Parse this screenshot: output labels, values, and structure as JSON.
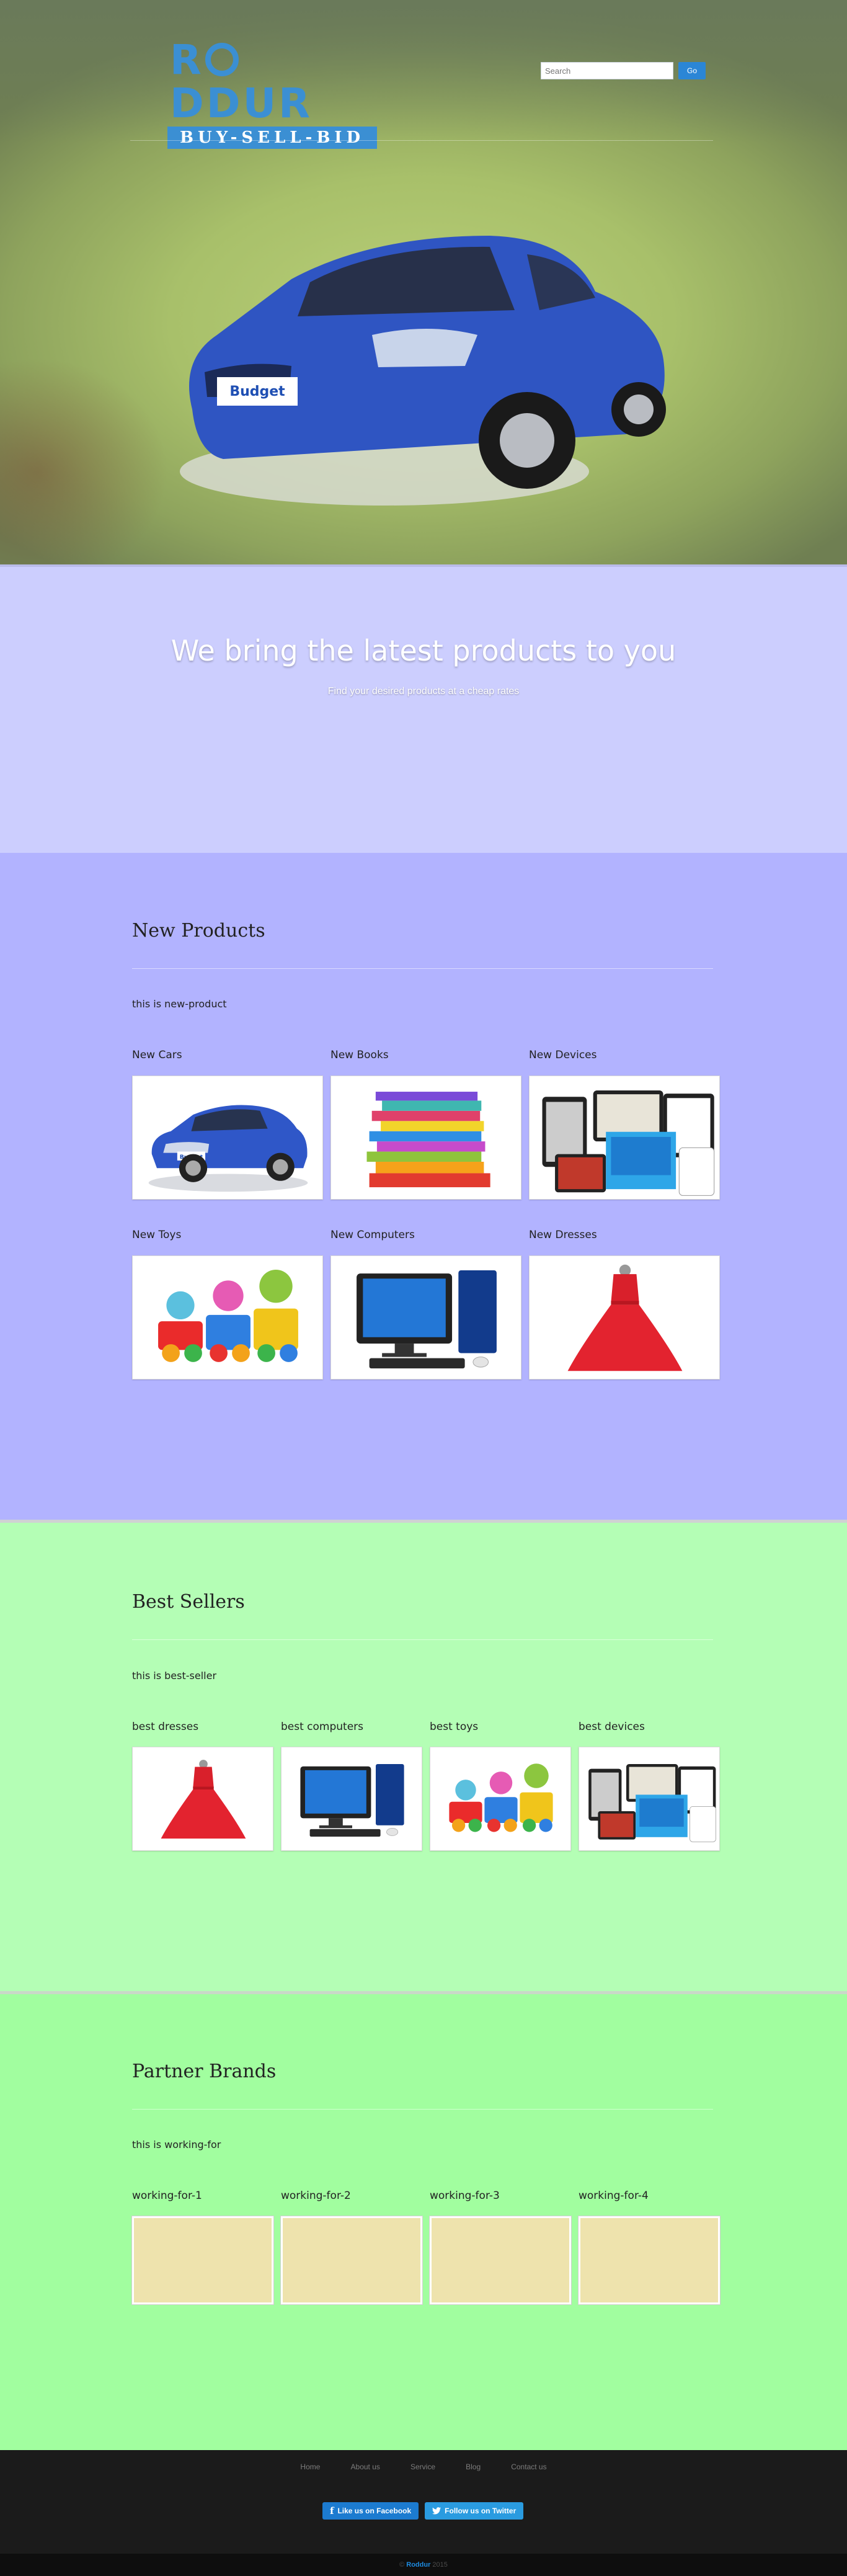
{
  "brand": {
    "name_part1": "R",
    "name_part2": "DDUR",
    "tagline": "BUY-SELL-BID"
  },
  "search": {
    "placeholder": "Search",
    "button": "Go"
  },
  "hero_banner": {
    "headline": "We bring the latest products to you",
    "subline": "Find your desired products at a cheap rates"
  },
  "new_products": {
    "title": "New Products",
    "subtitle": "this is new-product",
    "items": [
      {
        "label": "New Cars"
      },
      {
        "label": "New Books"
      },
      {
        "label": "New Devices"
      },
      {
        "label": "New Toys"
      },
      {
        "label": "New Computers"
      },
      {
        "label": "New Dresses"
      }
    ]
  },
  "best_sellers": {
    "title": "Best Sellers",
    "subtitle": "this is best-seller",
    "items": [
      {
        "label": "best dresses"
      },
      {
        "label": "best computers"
      },
      {
        "label": "best toys"
      },
      {
        "label": "best devices"
      }
    ]
  },
  "partners": {
    "title": "Partner Brands",
    "subtitle": "this is working-for",
    "items": [
      {
        "label": "working-for-1"
      },
      {
        "label": "working-for-2"
      },
      {
        "label": "working-for-3"
      },
      {
        "label": "working-for-4"
      }
    ]
  },
  "footer": {
    "nav": [
      "Home",
      "About us",
      "Service",
      "Blog",
      "Contact us"
    ],
    "facebook": "Like us on Facebook",
    "twitter": "Follow us on Twitter",
    "copyright_prefix": "© ",
    "copyright_brand": "Roddur",
    "copyright_year": " 2015"
  },
  "colors": {
    "accent": "#3b8fd3",
    "tagline_bg": "#cccefe",
    "new_bg": "#b2b3ff",
    "best_bg": "#b4feb5",
    "partner_bg": "#a1fe9f"
  }
}
